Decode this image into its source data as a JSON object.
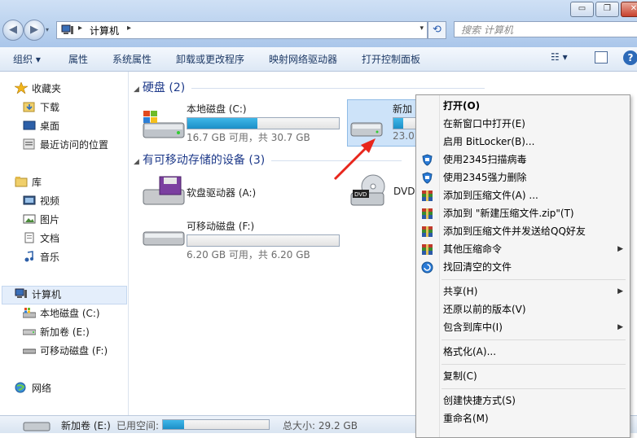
{
  "window": {
    "minimize_symbol": "▭",
    "maximize_symbol": "❐",
    "close_symbol": "✕"
  },
  "nav": {
    "back_symbol": "◀",
    "forward_symbol": "▶"
  },
  "address": {
    "current": "计算机",
    "separator": "▸",
    "dropdown_symbol": "▾"
  },
  "refresh_symbol": "⟲",
  "search": {
    "placeholder": "搜索 计算机"
  },
  "toolbar": {
    "organize": "组织 ▾",
    "properties": "属性",
    "system_properties": "系统属性",
    "uninstall": "卸载或更改程序",
    "map_drive": "映射网络驱动器",
    "control_panel": "打开控制面板",
    "view_symbol": "☷ ▾",
    "help_symbol": "?"
  },
  "sidebar": {
    "favorites": "收藏夹",
    "downloads": "下载",
    "desktop": "桌面",
    "recent": "最近访问的位置",
    "libraries": "库",
    "videos": "视频",
    "pictures": "图片",
    "documents": "文档",
    "music": "音乐",
    "computer": "计算机",
    "local_c": "本地磁盘 (C:)",
    "new_e": "新加卷 (E:)",
    "removable_f": "可移动磁盘 (F:)",
    "network": "网络"
  },
  "groups": {
    "hard_disks": "硬盘 (2)",
    "removable": "有可移动存储的设备 (3)"
  },
  "drives": {
    "c": {
      "name": "本地磁盘 (C:)",
      "usage": "16.7 GB 可用，共 30.7 GB",
      "used_fraction": 0.46
    },
    "e": {
      "name": "新加",
      "usage": "23.0",
      "used_fraction": 0.3
    },
    "floppy": {
      "name": "软盘驱动器 (A:)"
    },
    "dvd": {
      "name": "DVD",
      "badge": "DVD"
    },
    "f": {
      "name": "可移动磁盘 (F:)",
      "usage": "6.20 GB 可用，共 6.20 GB",
      "used_fraction": 0.0
    }
  },
  "statusbar": {
    "drive": "新加卷 (E:)",
    "used_label": "已用空间:",
    "used_fraction": 0.2,
    "total": "总大小: 29.2 GB"
  },
  "context_menu": {
    "open": "打开(O)",
    "open_new_window": "在新窗口中打开(E)",
    "bitlocker": "启用 BitLocker(B)...",
    "scan_2345": "使用2345扫描病毒",
    "shred_2345": "使用2345强力删除",
    "add_archive": "添加到压缩文件(A) ...",
    "add_zip": "添加到 \"新建压缩文件.zip\"(T)",
    "add_send_qq": "添加到压缩文件并发送给QQ好友",
    "other_compress": "其他压缩命令",
    "recover": "找回清空的文件",
    "share": "共享(H)",
    "restore_prev": "还原以前的版本(V)",
    "include_library": "包含到库中(I)",
    "format": "格式化(A)...",
    "copy": "复制(C)",
    "create_shortcut": "创建快捷方式(S)",
    "rename": "重命名(M)",
    "submenu_arrow": "▶"
  },
  "colors": {
    "accent": "#1c8fc7",
    "menu_bg": "#f5f5f5",
    "annotation_arrow": "#e8261c"
  }
}
